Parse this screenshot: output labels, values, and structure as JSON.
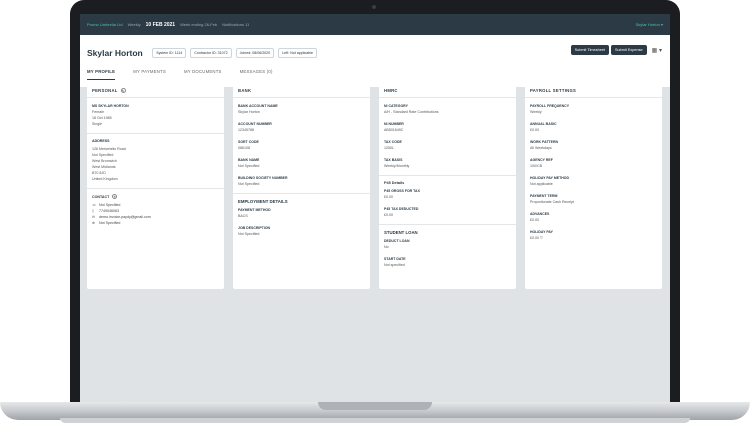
{
  "topbar": {
    "company": "Promo Umbrella Ltd",
    "pay_cycle": "Weekly",
    "date": "10 FEB 2021",
    "links": [
      "Week ending 26-Feb",
      "Notifications 11"
    ],
    "user": "Skylar Horton"
  },
  "profile": {
    "name": "Skylar Horton",
    "system_id": "System ID: 1114",
    "contractor_id": "Contractor ID: 31072",
    "joined": "Joined: 08/06/2020",
    "left": "Left: Not applicable"
  },
  "actions": {
    "submit_timesheet": "Submit Timesheet",
    "submit_expense": "Submit Expense"
  },
  "tabs": [
    "MY PROFILE",
    "MY PAYMENTS",
    "MY DOCUMENTS",
    "MESSAGES (0)"
  ],
  "personal": {
    "title": "PERSONAL",
    "name_upper": "MS SKYLAR HORTON",
    "gender": "Female",
    "dob": "18 Oct 1985",
    "marital": "Single",
    "address_label": "ADDRESS",
    "address_lines": [
      "126 Meriwhello Road",
      "Not Specified",
      "West Bromwich",
      "West Midlands",
      "B70 8JD",
      "United Kingdom"
    ],
    "contact_label": "CONTACT",
    "contact": [
      {
        "icon": "phone-icon",
        "glyph": "☏",
        "value": "Not Specified"
      },
      {
        "icon": "mobile-icon",
        "glyph": "▯",
        "value": "7749046063"
      },
      {
        "icon": "email-icon",
        "glyph": "✉",
        "value": "demo.invoice.paydy@gmail.com"
      },
      {
        "icon": "globe-icon",
        "glyph": "⊕",
        "value": "Not Specified"
      }
    ]
  },
  "bank": {
    "title": "BANK",
    "fields": [
      {
        "label": "BANK ACCOUNT NAME",
        "value": "Skylar Horton"
      },
      {
        "label": "ACCOUNT NUMBER",
        "value": "12345788"
      },
      {
        "label": "SORT CODE",
        "value": "086108"
      },
      {
        "label": "BANK NAME",
        "value": "Not Specified"
      },
      {
        "label": "BUILDING SOCIETY NUMBER",
        "value": "Not Specified"
      }
    ],
    "employment_title": "EMPLOYMENT DETAILS",
    "employment": [
      {
        "label": "PAYMENT METHOD",
        "value": "BACS"
      },
      {
        "label": "JOB DESCRIPTION",
        "value": "Not Specified"
      }
    ]
  },
  "hmrc": {
    "title": "HMRC",
    "fields": [
      {
        "label": "NI CATEGORY",
        "value": "A/H - Standard Rate Contributions"
      },
      {
        "label": "NI NUMBER",
        "value": "AB501649C"
      },
      {
        "label": "TAX CODE",
        "value": "1250L"
      },
      {
        "label": "TAX BASIS",
        "value": "Weekly/Monthly"
      }
    ],
    "p45_title": "P45 Details",
    "p45": [
      {
        "label": "P45 GROSS FOR TAX",
        "value": "£0.00"
      },
      {
        "label": "P45 TAX DEDUCTED",
        "value": "£0.00"
      }
    ],
    "loan_title": "STUDENT LOAN",
    "loan": [
      {
        "label": "DEDUCT LOAN",
        "value": "No"
      },
      {
        "label": "START DATE",
        "value": "Not specified"
      }
    ]
  },
  "payroll": {
    "title": "PAYROLL SETTINGS",
    "fields": [
      {
        "label": "PAYROLL FREQUENCY",
        "value": "Weekly"
      },
      {
        "label": "ANNUAL BASIC",
        "value": "£0.00"
      },
      {
        "label": "WORK PATTERN",
        "value": "All Weekdays"
      },
      {
        "label": "AGENCY REF",
        "value": "100/CB"
      },
      {
        "label": "HOLIDAY PAY METHOD",
        "value": "Not applicable"
      },
      {
        "label": "PAYMENT TERM",
        "value": "Proportionate Cash Receipt"
      },
      {
        "label": "ADVANCES",
        "value": "£0.00"
      },
      {
        "label": "HOLIDAY PAY",
        "value": "£0.00"
      }
    ]
  }
}
